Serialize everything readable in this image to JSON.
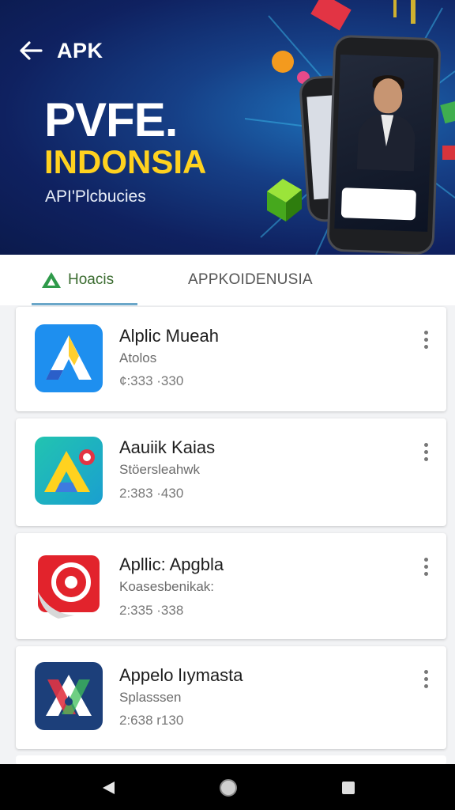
{
  "header": {
    "title": "APK",
    "back_icon": "arrow-left-icon"
  },
  "hero": {
    "title_line1": "PVFE.",
    "title_line2": "INDONSIA",
    "subtitle": "API'Plcbucies",
    "colors": {
      "line1": "#ffffff",
      "line2": "#ffd21f"
    }
  },
  "tabs": [
    {
      "label": "Hoacis",
      "icon": "a-logo-icon",
      "selected": true
    },
    {
      "label": "APPKOIDENUSIA",
      "selected": false
    }
  ],
  "apps": [
    {
      "name": "Alplic Mueah",
      "subtitle": "Atolos",
      "meta": "¢:333 ·330",
      "icon": "blue-a-app-icon"
    },
    {
      "name": "Aauiik Kaias",
      "subtitle": "Stöersleahwk",
      "meta": "2:383 ·430",
      "icon": "teal-yellow-a-app-icon"
    },
    {
      "name": "Apllic: Apgbla",
      "subtitle": "Koasesbenikak:",
      "meta": "2:335 ·338",
      "icon": "red-target-app-icon"
    },
    {
      "name": "Appelo lıymasta",
      "subtitle": "Splasssen",
      "meta": "2:638 r130",
      "icon": "navy-a-app-icon"
    }
  ],
  "navbar": {
    "back": "back-triangle-icon",
    "home": "home-circle-icon",
    "recents": "recents-square-icon"
  }
}
